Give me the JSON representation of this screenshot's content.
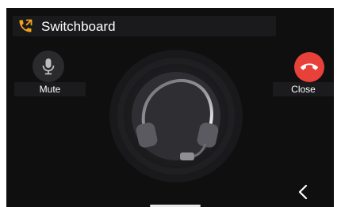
{
  "header": {
    "title": "Switchboard",
    "icon": "phone-call-icon",
    "icon_color": "#f3a21b"
  },
  "controls": {
    "mute_label": "Mute",
    "mute_icon": "microphone-icon",
    "close_label": "Close",
    "close_icon": "hangup-icon",
    "close_color": "#e8413a"
  },
  "center": {
    "icon": "headset-icon"
  },
  "nav": {
    "back_icon": "chevron-left-icon"
  }
}
